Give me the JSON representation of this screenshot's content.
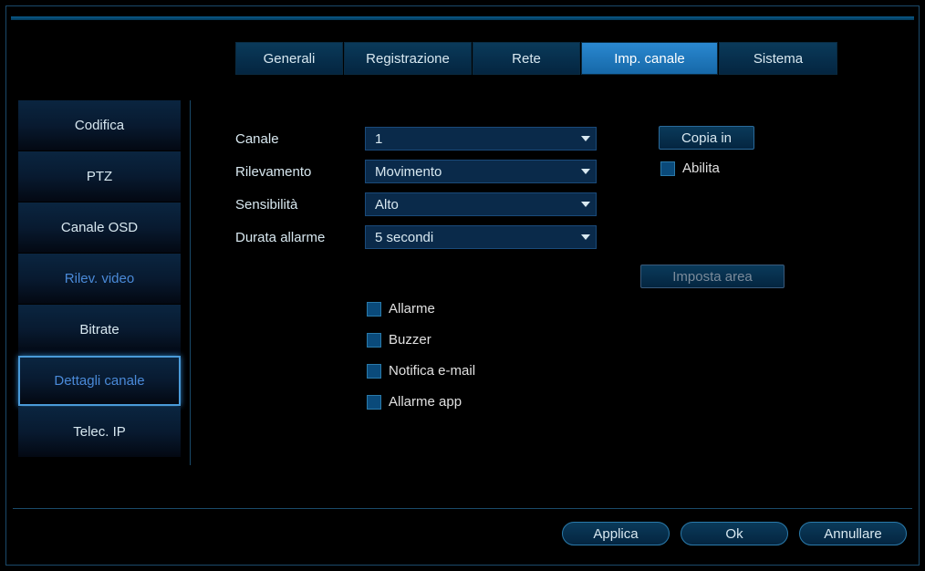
{
  "tabs": {
    "generali": "Generali",
    "registrazione": "Registrazione",
    "rete": "Rete",
    "imp_canale": "Imp. canale",
    "sistema": "Sistema"
  },
  "sidebar": {
    "codifica": "Codifica",
    "ptz": "PTZ",
    "canale_osd": "Canale OSD",
    "rilev_video": "Rilev. video",
    "bitrate": "Bitrate",
    "dettagli_canale": "Dettagli canale",
    "telec_ip": "Telec. IP"
  },
  "form": {
    "canale_label": "Canale",
    "canale_value": "1",
    "rilevamento_label": "Rilevamento",
    "rilevamento_value": "Movimento",
    "sensibilita_label": "Sensibilità",
    "sensibilita_value": "Alto",
    "durata_label": "Durata allarme",
    "durata_value": "5 secondi"
  },
  "buttons": {
    "copia_in": "Copia in",
    "imposta_area": "Imposta area",
    "applica": "Applica",
    "ok": "Ok",
    "annullare": "Annullare"
  },
  "checkboxes": {
    "abilita": "Abilita",
    "allarme": "Allarme",
    "buzzer": "Buzzer",
    "notifica_email": "Notifica e-mail",
    "allarme_app": "Allarme app"
  }
}
